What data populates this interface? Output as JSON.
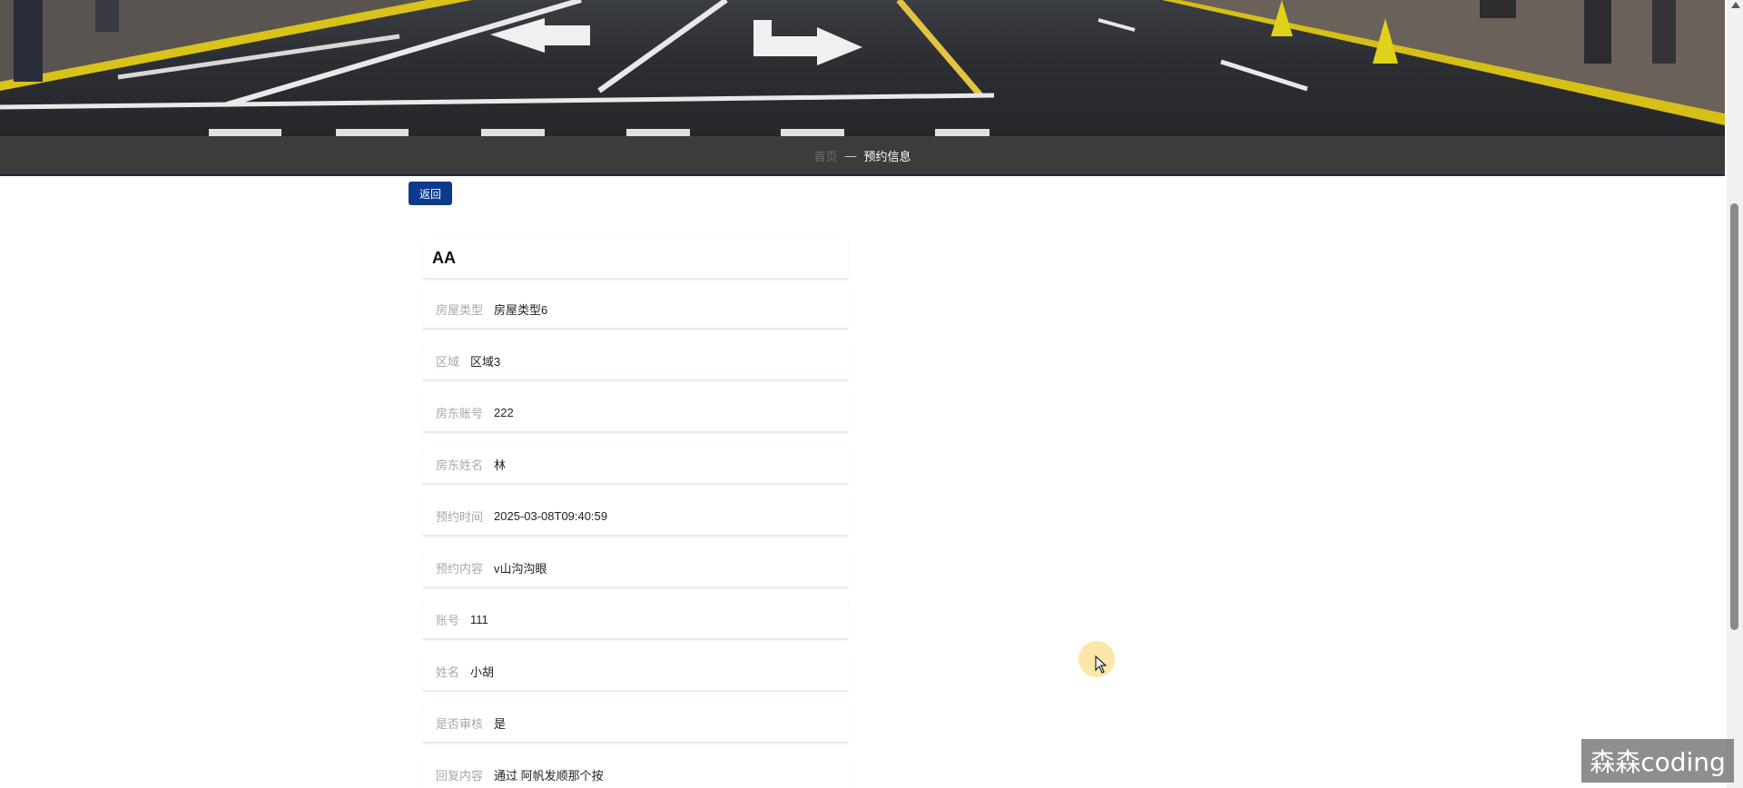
{
  "breadcrumb": {
    "home": "首页",
    "separator": "—",
    "current": "预约信息"
  },
  "back_button": {
    "label": "返回"
  },
  "detail": {
    "title": "AA",
    "fields": [
      {
        "label": "房屋类型",
        "value": "房屋类型6"
      },
      {
        "label": "区域",
        "value": "区域3"
      },
      {
        "label": "房东账号",
        "value": "222"
      },
      {
        "label": "房东姓名",
        "value": "林"
      },
      {
        "label": "预约时间",
        "value": "2025-03-08T09:40:59"
      },
      {
        "label": "预约内容",
        "value": "v山沟沟眼"
      },
      {
        "label": "账号",
        "value": "111"
      },
      {
        "label": "姓名",
        "value": "小胡"
      },
      {
        "label": "是否审核",
        "value": "是"
      },
      {
        "label": "回复内容",
        "value": "通过 阿帆发顺那个按"
      }
    ]
  },
  "watermark": {
    "text": "森森coding"
  },
  "colors": {
    "accent": "#0d3b8c",
    "breadcrumb_bar": "#3c3c3c",
    "label_gray": "#a8a8a8"
  },
  "icons": {
    "cursor": "pointer-arrow-icon",
    "scroll_up": "caret-up-icon"
  }
}
